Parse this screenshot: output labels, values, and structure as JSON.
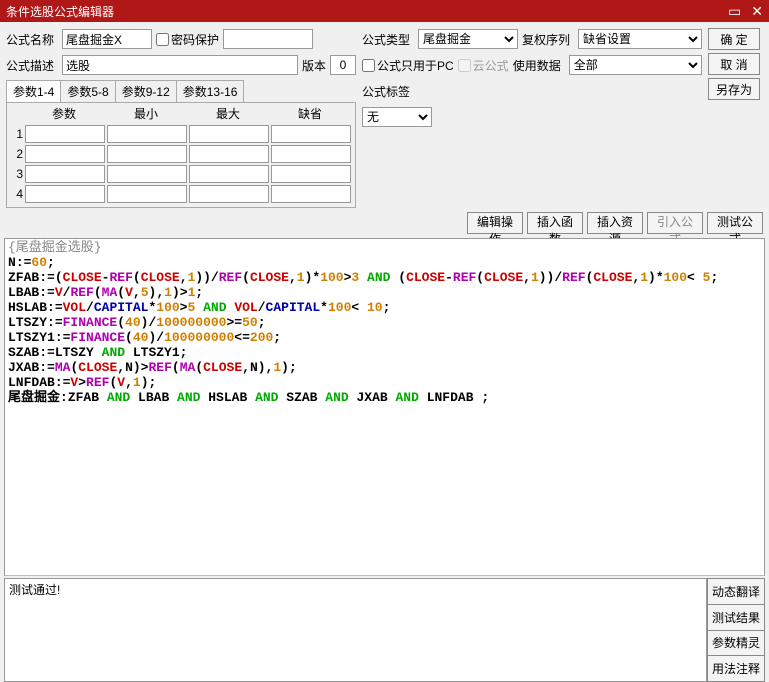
{
  "title": "条件选股公式编辑器",
  "labels": {
    "name": "公式名称",
    "desc": "公式描述",
    "pwd": "密码保护",
    "ver": "版本",
    "type": "公式类型",
    "rights": "复权序列",
    "pcOnly": "公式只用于PC",
    "cloud": "云公式",
    "useData": "使用数据",
    "tag": "公式标签",
    "paramName": "参数",
    "min": "最小",
    "max": "最大",
    "def": "缺省"
  },
  "fields": {
    "name": "尾盘掘金X",
    "desc": "选股",
    "version": "0",
    "typeSel": "尾盘掘金",
    "rightsSel": "缺省设置",
    "useDataSel": "全部",
    "tagSel": "无"
  },
  "tabs": [
    "参数1-4",
    "参数5-8",
    "参数9-12",
    "参数13-16"
  ],
  "buttons": {
    "ok": "确 定",
    "cancel": "取 消",
    "saveAs": "另存为",
    "editOp": "编辑操作",
    "insFn": "插入函数",
    "insRes": "插入资源",
    "impForm": "引入公式",
    "testForm": "测试公式",
    "dynTrans": "动态翻译",
    "testRes": "测试结果",
    "paramWiz": "参数精灵",
    "usage": "用法注释"
  },
  "editorHeader": "{尾盘掘金选股}",
  "code": [
    [
      [
        "sym",
        "N"
      ],
      [
        "sym",
        ":="
      ],
      [
        "num",
        "60"
      ],
      [
        "sym",
        ";"
      ]
    ],
    [
      [
        "sym",
        "ZFAB"
      ],
      [
        "sym",
        ":="
      ],
      [
        "sym",
        "("
      ],
      [
        "red",
        "CLOSE"
      ],
      [
        "sym",
        "-"
      ],
      [
        "fn",
        "REF"
      ],
      [
        "sym",
        "("
      ],
      [
        "red",
        "CLOSE"
      ],
      [
        "sym",
        ","
      ],
      [
        "num",
        "1"
      ],
      [
        "sym",
        "))/"
      ],
      [
        "fn",
        "REF"
      ],
      [
        "sym",
        "("
      ],
      [
        "red",
        "CLOSE"
      ],
      [
        "sym",
        ","
      ],
      [
        "num",
        "1"
      ],
      [
        "sym",
        ")*"
      ],
      [
        "num",
        "100"
      ],
      [
        "sym",
        ">"
      ],
      [
        "num",
        "3"
      ],
      [
        "sym",
        " "
      ],
      [
        "kw",
        "AND"
      ],
      [
        "sym",
        " ("
      ],
      [
        "red",
        "CLOSE"
      ],
      [
        "sym",
        "-"
      ],
      [
        "fn",
        "REF"
      ],
      [
        "sym",
        "("
      ],
      [
        "red",
        "CLOSE"
      ],
      [
        "sym",
        ","
      ],
      [
        "num",
        "1"
      ],
      [
        "sym",
        "))/"
      ],
      [
        "fn",
        "REF"
      ],
      [
        "sym",
        "("
      ],
      [
        "red",
        "CLOSE"
      ],
      [
        "sym",
        ","
      ],
      [
        "num",
        "1"
      ],
      [
        "sym",
        ")*"
      ],
      [
        "num",
        "100"
      ],
      [
        "sym",
        "< "
      ],
      [
        "num",
        "5"
      ],
      [
        "sym",
        ";"
      ]
    ],
    [
      [
        "sym",
        "LBAB"
      ],
      [
        "sym",
        ":="
      ],
      [
        "red",
        "V"
      ],
      [
        "sym",
        "/"
      ],
      [
        "fn",
        "REF"
      ],
      [
        "sym",
        "("
      ],
      [
        "fn",
        "MA"
      ],
      [
        "sym",
        "("
      ],
      [
        "red",
        "V"
      ],
      [
        "sym",
        ","
      ],
      [
        "num",
        "5"
      ],
      [
        "sym",
        "),"
      ],
      [
        "num",
        "1"
      ],
      [
        "sym",
        ")>"
      ],
      [
        "num",
        "1"
      ],
      [
        "sym",
        ";"
      ]
    ],
    [
      [
        "sym",
        "HSLAB"
      ],
      [
        "sym",
        ":="
      ],
      [
        "red",
        "VOL"
      ],
      [
        "sym",
        "/"
      ],
      [
        "var",
        "CAPITAL"
      ],
      [
        "sym",
        "*"
      ],
      [
        "num",
        "100"
      ],
      [
        "sym",
        ">"
      ],
      [
        "num",
        "5"
      ],
      [
        "sym",
        " "
      ],
      [
        "kw",
        "AND"
      ],
      [
        "sym",
        " "
      ],
      [
        "red",
        "VOL"
      ],
      [
        "sym",
        "/"
      ],
      [
        "var",
        "CAPITAL"
      ],
      [
        "sym",
        "*"
      ],
      [
        "num",
        "100"
      ],
      [
        "sym",
        "< "
      ],
      [
        "num",
        "10"
      ],
      [
        "sym",
        ";"
      ]
    ],
    [
      [
        "sym",
        "LTSZY"
      ],
      [
        "sym",
        ":="
      ],
      [
        "fn",
        "FINANCE"
      ],
      [
        "sym",
        "("
      ],
      [
        "num",
        "40"
      ],
      [
        "sym",
        ")/"
      ],
      [
        "num",
        "100000000"
      ],
      [
        "sym",
        ">="
      ],
      [
        "num",
        "50"
      ],
      [
        "sym",
        ";"
      ]
    ],
    [
      [
        "sym",
        "LTSZY1"
      ],
      [
        "sym",
        ":="
      ],
      [
        "fn",
        "FINANCE"
      ],
      [
        "sym",
        "("
      ],
      [
        "num",
        "40"
      ],
      [
        "sym",
        ")/"
      ],
      [
        "num",
        "100000000"
      ],
      [
        "sym",
        "<="
      ],
      [
        "num",
        "200"
      ],
      [
        "sym",
        ";"
      ]
    ],
    [
      [
        "sym",
        "SZAB"
      ],
      [
        "sym",
        ":="
      ],
      [
        "sym",
        "LTSZY "
      ],
      [
        "kw",
        "AND"
      ],
      [
        "sym",
        " LTSZY1;"
      ]
    ],
    [
      [
        "sym",
        "JXAB"
      ],
      [
        "sym",
        ":="
      ],
      [
        "fn",
        "MA"
      ],
      [
        "sym",
        "("
      ],
      [
        "red",
        "CLOSE"
      ],
      [
        "sym",
        ",N)>"
      ],
      [
        "fn",
        "REF"
      ],
      [
        "sym",
        "("
      ],
      [
        "fn",
        "MA"
      ],
      [
        "sym",
        "("
      ],
      [
        "red",
        "CLOSE"
      ],
      [
        "sym",
        ",N),"
      ],
      [
        "num",
        "1"
      ],
      [
        "sym",
        ");"
      ]
    ],
    [
      [
        "sym",
        "LNFDAB"
      ],
      [
        "sym",
        ":="
      ],
      [
        "red",
        "V"
      ],
      [
        "sym",
        ">"
      ],
      [
        "fn",
        "REF"
      ],
      [
        "sym",
        "("
      ],
      [
        "red",
        "V"
      ],
      [
        "sym",
        ","
      ],
      [
        "num",
        "1"
      ],
      [
        "sym",
        ");"
      ]
    ],
    [
      [
        "sym",
        "尾盘掘金:"
      ],
      [
        "sym",
        "ZFAB "
      ],
      [
        "kw",
        "AND"
      ],
      [
        "sym",
        " LBAB "
      ],
      [
        "kw",
        "AND"
      ],
      [
        "sym",
        " HSLAB "
      ],
      [
        "kw",
        "AND"
      ],
      [
        "sym",
        " SZAB "
      ],
      [
        "kw",
        "AND"
      ],
      [
        "sym",
        " JXAB "
      ],
      [
        "kw",
        "AND"
      ],
      [
        "sym",
        " LNFDAB ;"
      ]
    ]
  ],
  "output": "测试通过!"
}
